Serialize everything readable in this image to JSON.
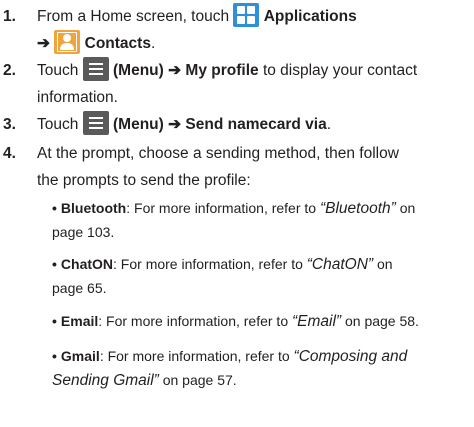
{
  "steps": [
    {
      "number": "1.",
      "line1_pre": "From a Home screen, touch",
      "applications": "Applications",
      "arrow": "➔",
      "contacts": "Contacts",
      "end": "."
    },
    {
      "number": "2.",
      "touch": "Touch",
      "menu": "(Menu)",
      "arrow": "➔",
      "target": "My profile",
      "rest1": "to display your contact",
      "rest2": "information."
    },
    {
      "number": "3.",
      "touch": "Touch",
      "menu": "(Menu)",
      "arrow": "➔",
      "target": "Send namecard via",
      "end": "."
    },
    {
      "number": "4.",
      "line1": "At the prompt, choose a sending method, then follow",
      "line2": "the prompts to send the profile:"
    }
  ],
  "bullets": [
    {
      "bullet": "•",
      "term": "Bluetooth",
      "sep": ": For more information, refer to",
      "ref": "“Bluetooth”",
      "tail1": "on",
      "tail2": "page 103."
    },
    {
      "bullet": "•",
      "term": "ChatON",
      "sep": ": For more information, refer to",
      "ref": "“ChatON”",
      "tail1": "on",
      "tail2": "page 65."
    },
    {
      "bullet": "•",
      "term": "Email",
      "sep": ": For more information, refer to",
      "ref": "“Email”",
      "tail1": "on page 58."
    },
    {
      "bullet": "•",
      "term": "Gmail",
      "sep": ": For more information, refer to",
      "ref1": "“Composing and",
      "ref2": "Sending Gmail”",
      "tail2": "on page 57."
    }
  ],
  "icons": {
    "applications": "applications-grid-icon",
    "contacts": "contacts-icon",
    "menu": "menu-key-icon"
  },
  "colors": {
    "text": "#231f20",
    "applications_icon": "#2f8fd8",
    "contacts_icon": "#f0a43c",
    "menu_icon": "#5a5a5a"
  }
}
